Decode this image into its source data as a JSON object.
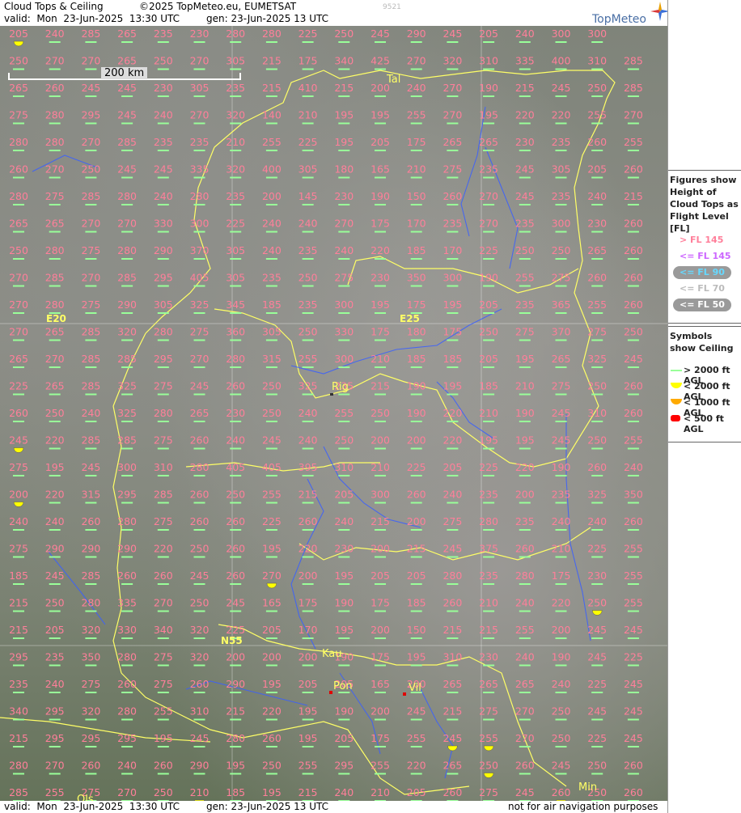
{
  "header": {
    "title": "Cloud Tops & Ceiling",
    "copyright": "©2025 TopMeteo.eu, EUMETSAT",
    "valid": "valid:  Mon  23-Jun-2025  13:30 UTC",
    "gen": "gen: 23-Jun-2025 13 UTC",
    "code": "9521",
    "logo": "TopMeteo"
  },
  "footer": {
    "valid": "valid:  Mon  23-Jun-2025  13:30 UTC",
    "gen": "gen: 23-Jun-2025 13 UTC",
    "disclaimer": "not for air navigation purposes"
  },
  "scale": "200 km",
  "legend": {
    "heading": "Figures show Height of Cloud Tops as Flight Level  [FL]",
    "fl": [
      {
        "label": "> FL 145",
        "color": "#ff7f9a",
        "pill": false
      },
      {
        "label": "<= FL 145",
        "color": "#cc66ff",
        "pill": false
      },
      {
        "label": "<= FL 90",
        "color": "#66d9ff",
        "pill": true
      },
      {
        "label": "<= FL 70",
        "color": "#bbbbbb",
        "pill": false
      },
      {
        "label": "<= FL 50",
        "color": "#ffffff",
        "pill": true
      }
    ],
    "symbols_heading": "Symbols show Ceiling",
    "symbols": [
      {
        "label": "> 2000 ft AGL",
        "color": "#99ff99",
        "shape": "line"
      },
      {
        "label": "< 2000 ft AGL",
        "color": "#ffff00",
        "shape": "half"
      },
      {
        "label": "< 1000 ft AGL",
        "color": "#ffaa00",
        "shape": "half"
      },
      {
        "label": "< 500 ft AGL",
        "color": "#ff0000",
        "shape": "rect"
      }
    ]
  },
  "cities": [
    "Tal",
    "Rig",
    "Kau",
    "Pon",
    "Vil",
    "Min",
    "Ols"
  ],
  "roads": [
    "E20",
    "E25",
    "N55"
  ],
  "grid": {
    "yellow_cells": [
      [
        0,
        0
      ],
      [
        15,
        0
      ],
      [
        17,
        0
      ],
      [
        20,
        7
      ],
      [
        21,
        16
      ],
      [
        26,
        13
      ],
      [
        26,
        12
      ],
      [
        27,
        13
      ],
      [
        28,
        15
      ],
      [
        28,
        5
      ],
      [
        29,
        14
      ]
    ],
    "rows": [
      [
        "205",
        "240",
        "285",
        "265",
        "235",
        "230",
        "280",
        "280",
        "225",
        "250",
        "245",
        "290",
        "245",
        "205",
        "240",
        "300",
        "300"
      ],
      [
        "250",
        "270",
        "270",
        "265",
        "250",
        "270",
        "305",
        "215",
        "175",
        "340",
        "425",
        "270",
        "320",
        "310",
        "335",
        "400",
        "310",
        "285"
      ],
      [
        "265",
        "260",
        "245",
        "245",
        "230",
        "305",
        "235",
        "215",
        "410",
        "215",
        "200",
        "240",
        "270",
        "190",
        "215",
        "245",
        "250",
        "285"
      ],
      [
        "275",
        "280",
        "295",
        "245",
        "240",
        "270",
        "320",
        "140",
        "210",
        "195",
        "195",
        "255",
        "270",
        "195",
        "220",
        "220",
        "255",
        "270"
      ],
      [
        "280",
        "280",
        "270",
        "285",
        "235",
        "235",
        "210",
        "255",
        "225",
        "195",
        "205",
        "175",
        "265",
        "265",
        "230",
        "235",
        "260",
        "255"
      ],
      [
        "260",
        "270",
        "250",
        "245",
        "245",
        "335",
        "320",
        "400",
        "305",
        "180",
        "165",
        "210",
        "275",
        "235",
        "245",
        "305",
        "205",
        "260"
      ],
      [
        "280",
        "275",
        "285",
        "280",
        "240",
        "280",
        "235",
        "200",
        "145",
        "230",
        "190",
        "150",
        "260",
        "270",
        "245",
        "235",
        "240",
        "215"
      ],
      [
        "265",
        "265",
        "270",
        "270",
        "330",
        "300",
        "225",
        "240",
        "240",
        "270",
        "175",
        "170",
        "235",
        "270",
        "235",
        "300",
        "230",
        "260"
      ],
      [
        "250",
        "280",
        "275",
        "280",
        "290",
        "370",
        "305",
        "240",
        "235",
        "240",
        "220",
        "185",
        "170",
        "225",
        "250",
        "250",
        "265",
        "260"
      ],
      [
        "270",
        "285",
        "270",
        "285",
        "295",
        "405",
        "305",
        "235",
        "250",
        "275",
        "230",
        "350",
        "300",
        "190",
        "255",
        "275",
        "260",
        "260"
      ],
      [
        "270",
        "280",
        "275",
        "290",
        "305",
        "325",
        "345",
        "185",
        "235",
        "300",
        "195",
        "175",
        "195",
        "205",
        "235",
        "365",
        "255",
        "260"
      ],
      [
        "270",
        "265",
        "285",
        "320",
        "280",
        "275",
        "360",
        "305",
        "250",
        "330",
        "175",
        "180",
        "175",
        "250",
        "275",
        "370",
        "275",
        "250"
      ],
      [
        "265",
        "270",
        "285",
        "285",
        "295",
        "270",
        "280",
        "315",
        "255",
        "300",
        "210",
        "185",
        "185",
        "205",
        "195",
        "265",
        "325",
        "245"
      ],
      [
        "225",
        "265",
        "285",
        "325",
        "275",
        "245",
        "260",
        "250",
        "325",
        "235",
        "215",
        "190",
        "195",
        "185",
        "210",
        "275",
        "250",
        "260"
      ],
      [
        "260",
        "250",
        "240",
        "325",
        "280",
        "265",
        "230",
        "250",
        "240",
        "255",
        "250",
        "190",
        "220",
        "210",
        "190",
        "245",
        "310",
        "260"
      ],
      [
        "245",
        "220",
        "285",
        "285",
        "275",
        "260",
        "240",
        "245",
        "240",
        "250",
        "200",
        "200",
        "220",
        "195",
        "195",
        "245",
        "250",
        "255"
      ],
      [
        "275",
        "195",
        "245",
        "300",
        "310",
        "280",
        "405",
        "405",
        "395",
        "310",
        "210",
        "225",
        "205",
        "225",
        "220",
        "190",
        "260",
        "240"
      ],
      [
        "200",
        "220",
        "315",
        "295",
        "285",
        "260",
        "250",
        "255",
        "215",
        "205",
        "300",
        "260",
        "240",
        "235",
        "200",
        "235",
        "325",
        "350"
      ],
      [
        "240",
        "240",
        "260",
        "280",
        "275",
        "260",
        "260",
        "225",
        "260",
        "240",
        "215",
        "200",
        "275",
        "280",
        "235",
        "240",
        "240",
        "260"
      ],
      [
        "275",
        "290",
        "290",
        "290",
        "220",
        "250",
        "260",
        "195",
        "220",
        "230",
        "200",
        "215",
        "245",
        "375",
        "260",
        "210",
        "225",
        "255"
      ],
      [
        "185",
        "245",
        "285",
        "260",
        "260",
        "245",
        "260",
        "270",
        "200",
        "195",
        "205",
        "205",
        "280",
        "235",
        "280",
        "175",
        "230",
        "255"
      ],
      [
        "215",
        "250",
        "280",
        "335",
        "270",
        "250",
        "245",
        "165",
        "175",
        "190",
        "175",
        "185",
        "260",
        "210",
        "240",
        "220",
        "250",
        "255"
      ],
      [
        "215",
        "205",
        "320",
        "330",
        "340",
        "320",
        "225",
        "205",
        "170",
        "195",
        "200",
        "150",
        "215",
        "215",
        "255",
        "200",
        "245",
        "245"
      ],
      [
        "295",
        "235",
        "350",
        "280",
        "275",
        "320",
        "200",
        "200",
        "200",
        "190",
        "175",
        "195",
        "310",
        "230",
        "240",
        "190",
        "245",
        "225"
      ],
      [
        "235",
        "240",
        "275",
        "260",
        "275",
        "260",
        "290",
        "195",
        "205",
        "205",
        "165",
        "200",
        "265",
        "265",
        "265",
        "240",
        "225",
        "245"
      ],
      [
        "340",
        "295",
        "320",
        "280",
        "255",
        "310",
        "215",
        "220",
        "195",
        "190",
        "200",
        "245",
        "215",
        "275",
        "270",
        "250",
        "245",
        "245"
      ],
      [
        "215",
        "295",
        "295",
        "295",
        "195",
        "245",
        "280",
        "260",
        "195",
        "205",
        "175",
        "255",
        "245",
        "255",
        "270",
        "250",
        "225",
        "245"
      ],
      [
        "280",
        "270",
        "260",
        "240",
        "260",
        "290",
        "195",
        "250",
        "255",
        "295",
        "255",
        "220",
        "265",
        "250",
        "260",
        "245",
        "250",
        "260"
      ],
      [
        "285",
        "255",
        "275",
        "270",
        "250",
        "210",
        "185",
        "195",
        "215",
        "240",
        "210",
        "205",
        "260",
        "275",
        "245",
        "260",
        "250",
        "260"
      ]
    ]
  }
}
